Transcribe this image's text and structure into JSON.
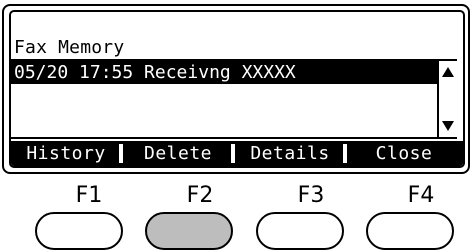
{
  "screen": {
    "title": "Fax Memory",
    "list": [
      {
        "text": "05/20 17:55 Receivng XXXXX",
        "selected": true
      }
    ]
  },
  "softkeys": [
    {
      "label": "History"
    },
    {
      "label": "Delete"
    },
    {
      "label": "Details"
    },
    {
      "label": "Close"
    }
  ],
  "hardware_buttons": [
    {
      "label": "F1",
      "pressed": false
    },
    {
      "label": "F2",
      "pressed": true
    },
    {
      "label": "F3",
      "pressed": false
    },
    {
      "label": "F4",
      "pressed": false
    }
  ],
  "icons": {
    "scroll_up": "triangle-up-icon",
    "scroll_down": "triangle-down-icon"
  },
  "colors": {
    "highlight": "#000000",
    "pressed_button": "#bdbdbd"
  }
}
